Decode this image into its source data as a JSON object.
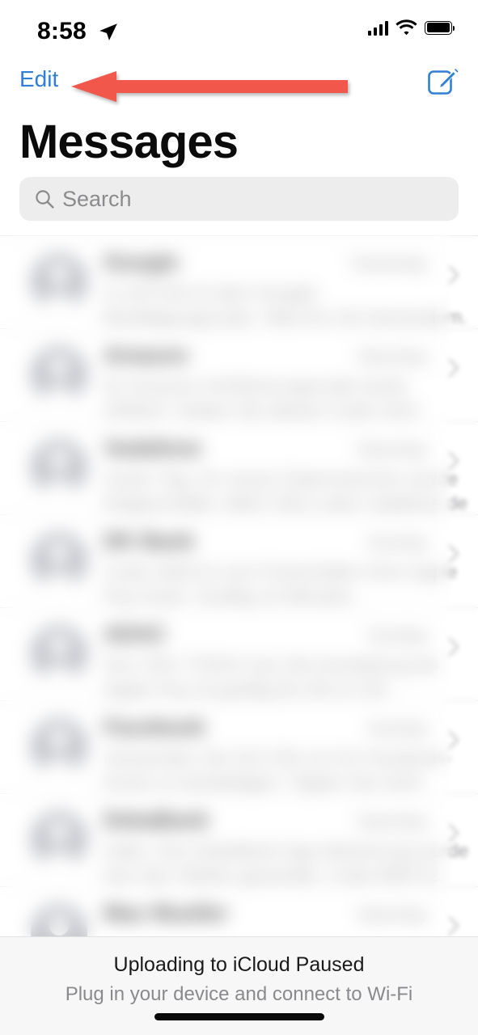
{
  "statusbar": {
    "time": "8:58",
    "location_icon": "location-arrow-icon",
    "cellular_icon": "cellular-bars-icon",
    "cellular_bars": 4,
    "wifi_icon": "wifi-icon",
    "battery_icon": "battery-full-icon",
    "battery_level": 100
  },
  "navbar": {
    "edit_label": "Edit",
    "edit_color": "#2f7fd6",
    "compose_icon": "compose-icon",
    "compose_color": "#2f7fd6"
  },
  "annotation": {
    "type": "arrow",
    "direction": "left",
    "color": "#f1584b",
    "points_to": "Edit"
  },
  "header": {
    "title": "Messages"
  },
  "search": {
    "placeholder": "Search",
    "value": "",
    "icon": "search-icon",
    "background": "#ededed"
  },
  "list": {
    "redacted": true,
    "avatar_icon": "person-placeholder-icon",
    "avatar_color": "#a8abb3",
    "chevron_icon": "chevron-right-icon",
    "rows": [
      {
        "name": "Google",
        "time": "Yesterday",
        "preview": "G-187146 ist dein Google-Bestätigungscode. Teile ihn mit niemandem.",
        "edge_text": ""
      },
      {
        "name": "Amazon",
        "time": "Saturday",
        "preview": "Ihr Amazon-Verifizierungscode lautet 294810. Geben Sie diesen Code nicht weiter.",
        "edge_text": "..."
      },
      {
        "name": "Vodafone",
        "time": "Saturday",
        "preview": "Guten Tag, Ihr neues Datenvolumen wurde freigeschaltet. Mehr Infos unter vodafone.de",
        "edge_text": "..."
      },
      {
        "name": "DK Bank",
        "time": "Sunday",
        "preview": "Code 448213 zum Freischalten Ihrer Apple Pay Karte. Gueltig 10 Minuten.",
        "edge_text": ".."
      },
      {
        "name": "ADAC",
        "time": "Sunday",
        "preview": "Ihre TAN 778341 fuer die Anmeldung bei Apple Pay ist gueltig bis 09:12 Uhr.",
        "edge_text": "."
      },
      {
        "name": "Facebook",
        "time": "Sunday",
        "preview": "Verwenden Sie 615 204 um Ihr Facebook-Konto zu bestaetigen. Tippen Sie nicht darauf.",
        "edge_text": "ni"
      },
      {
        "name": "DekaBank",
        "time": "Saturday",
        "preview": "Hallo, Ihre DekaBank App Aktivierung wurde fuer das Telefon gesendet. Code 908712.",
        "edge_text": "le"
      },
      {
        "name": "Max Mueller",
        "time": "Saturday",
        "preview": "",
        "edge_text": ""
      }
    ]
  },
  "banner": {
    "title": "Uploading to iCloud Paused",
    "subtitle": "Plug in your device and connect to Wi-Fi"
  },
  "home_indicator": {
    "label": "home-indicator"
  }
}
